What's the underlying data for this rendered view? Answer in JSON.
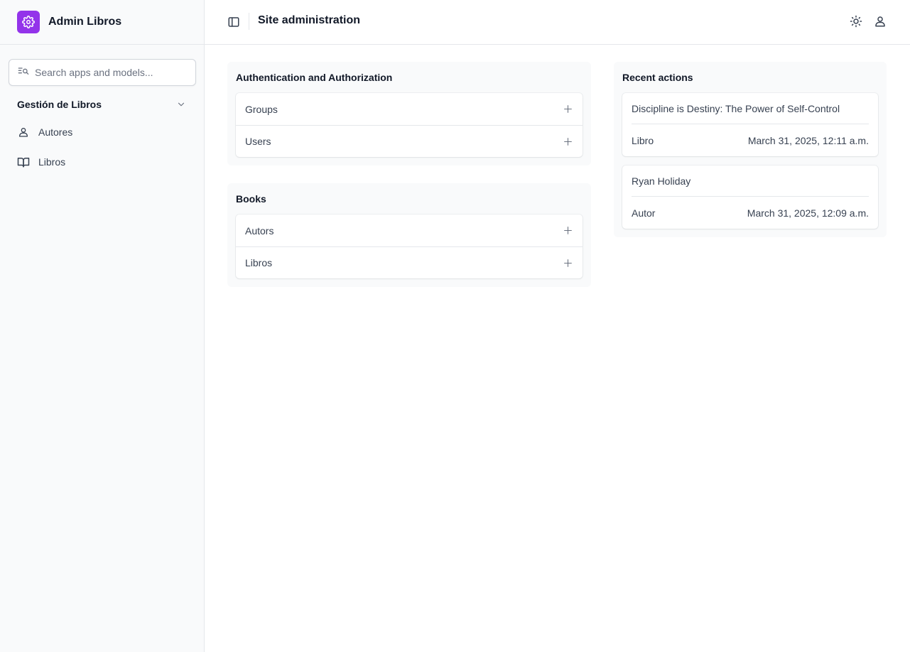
{
  "brand": {
    "title": "Admin Libros"
  },
  "search": {
    "placeholder": "Search apps and models..."
  },
  "sidebar": {
    "group_title": "Gestión de Libros",
    "items": [
      {
        "label": "Autores",
        "icon": "person-icon"
      },
      {
        "label": "Libros",
        "icon": "book-icon"
      }
    ]
  },
  "header": {
    "title": "Site administration"
  },
  "modules": [
    {
      "title": "Authentication and Authorization",
      "models": [
        "Groups",
        "Users"
      ]
    },
    {
      "title": "Books",
      "models": [
        "Autors",
        "Libros"
      ]
    }
  ],
  "recent": {
    "title": "Recent actions",
    "actions": [
      {
        "name": "Discipline is Destiny: The Power of Self-Control",
        "type": "Libro",
        "time": "March 31, 2025, 12:11 a.m."
      },
      {
        "name": "Ryan Holiday",
        "type": "Autor",
        "time": "March 31, 2025, 12:09 a.m."
      }
    ]
  },
  "colors": {
    "accent": "#9333ea",
    "sidebar_bg": "#f9fafb",
    "border": "#e5e7eb"
  }
}
